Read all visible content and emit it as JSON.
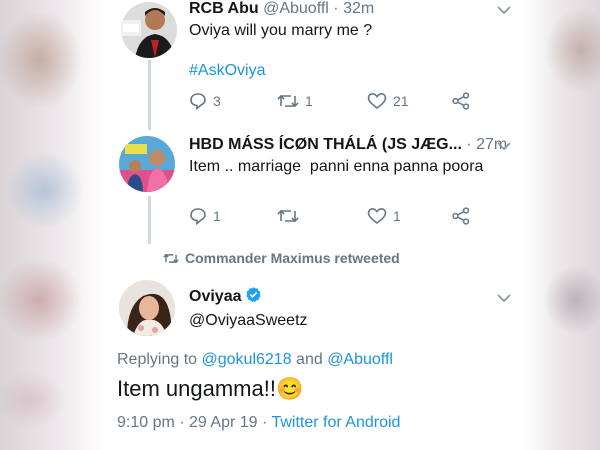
{
  "tweets": [
    {
      "name": "RCB Abu",
      "handle": "@Abuoffl",
      "time": "· 32m",
      "text": "Oviya will you marry me ?",
      "hashtag": "#AskOviya",
      "replies": "3",
      "retweets": "1",
      "likes": "21"
    },
    {
      "name": "HBD MÁSS ÍCØN THÁLÁ (JS JÆG...",
      "time": "· 27m",
      "text": "Item .. marriage  panni enna panna poora",
      "replies": "1",
      "retweets": "",
      "likes": "1"
    }
  ],
  "retweeted_by": "Commander Maximus retweeted",
  "main_tweet": {
    "name": "Oviyaa",
    "handle": "@OviyaaSweetz",
    "replying_prefix": "Replying to ",
    "reply_user1": "@gokul6218",
    "reply_and": " and ",
    "reply_user2": "@Abuoffl",
    "text": "Item ungamma!!",
    "emoji": "😊",
    "time": "9:10 pm",
    "sep1": " · ",
    "date": "29 Apr 19",
    "sep2": " · ",
    "source": "Twitter for Android"
  },
  "colors": {
    "link": "#1b95e0",
    "secondary": "#657786",
    "verified": "#1da1f2"
  },
  "icons": [
    "reply-icon",
    "retweet-icon",
    "like-icon",
    "share-icon",
    "chevron-down-icon",
    "verified-icon"
  ]
}
